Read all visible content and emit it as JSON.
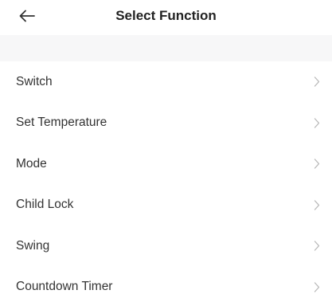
{
  "header": {
    "title": "Select Function",
    "back_icon": "arrow-left-icon"
  },
  "functions": [
    {
      "label": "Switch",
      "icon": "chevron-right-icon"
    },
    {
      "label": "Set Temperature",
      "icon": "chevron-right-icon"
    },
    {
      "label": "Mode",
      "icon": "chevron-right-icon"
    },
    {
      "label": "Child Lock",
      "icon": "chevron-right-icon"
    },
    {
      "label": "Swing",
      "icon": "chevron-right-icon"
    },
    {
      "label": "Countdown Timer",
      "icon": "chevron-right-icon"
    }
  ],
  "colors": {
    "title_text": "#222222",
    "item_text": "#333333",
    "separator_band": "#f7f7f8",
    "chevron": "#b8b8b8"
  }
}
